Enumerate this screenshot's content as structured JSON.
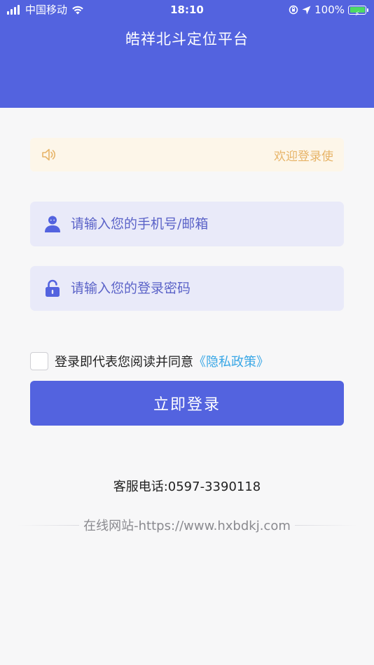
{
  "status_bar": {
    "carrier": "中国移动",
    "time": "18:10",
    "battery": "100%",
    "battery_level": 1.0,
    "icons": [
      "signal-bars-icon",
      "wifi-icon",
      "orientation-lock-icon",
      "location-arrow-icon",
      "battery-charging-icon"
    ]
  },
  "header": {
    "title": "皓祥北斗定位平台",
    "color": "#5363df"
  },
  "notice": {
    "icon": "speaker-icon",
    "text": "欢迎登录使"
  },
  "form": {
    "account": {
      "icon": "user-icon",
      "value": "",
      "placeholder": "请输入您的手机号/邮箱"
    },
    "password": {
      "icon": "lock-icon",
      "value": "",
      "placeholder": "请输入您的登录密码"
    },
    "agreement": {
      "checked": false,
      "text": "登录即代表您阅读并同意",
      "link": "《隐私政策》",
      "link_color": "#39a7e6"
    },
    "login_label": "立即登录"
  },
  "footer": {
    "hotline": "客服电话:0597-3390118",
    "website": "在线网站-https://www.hxbdkj.com"
  }
}
